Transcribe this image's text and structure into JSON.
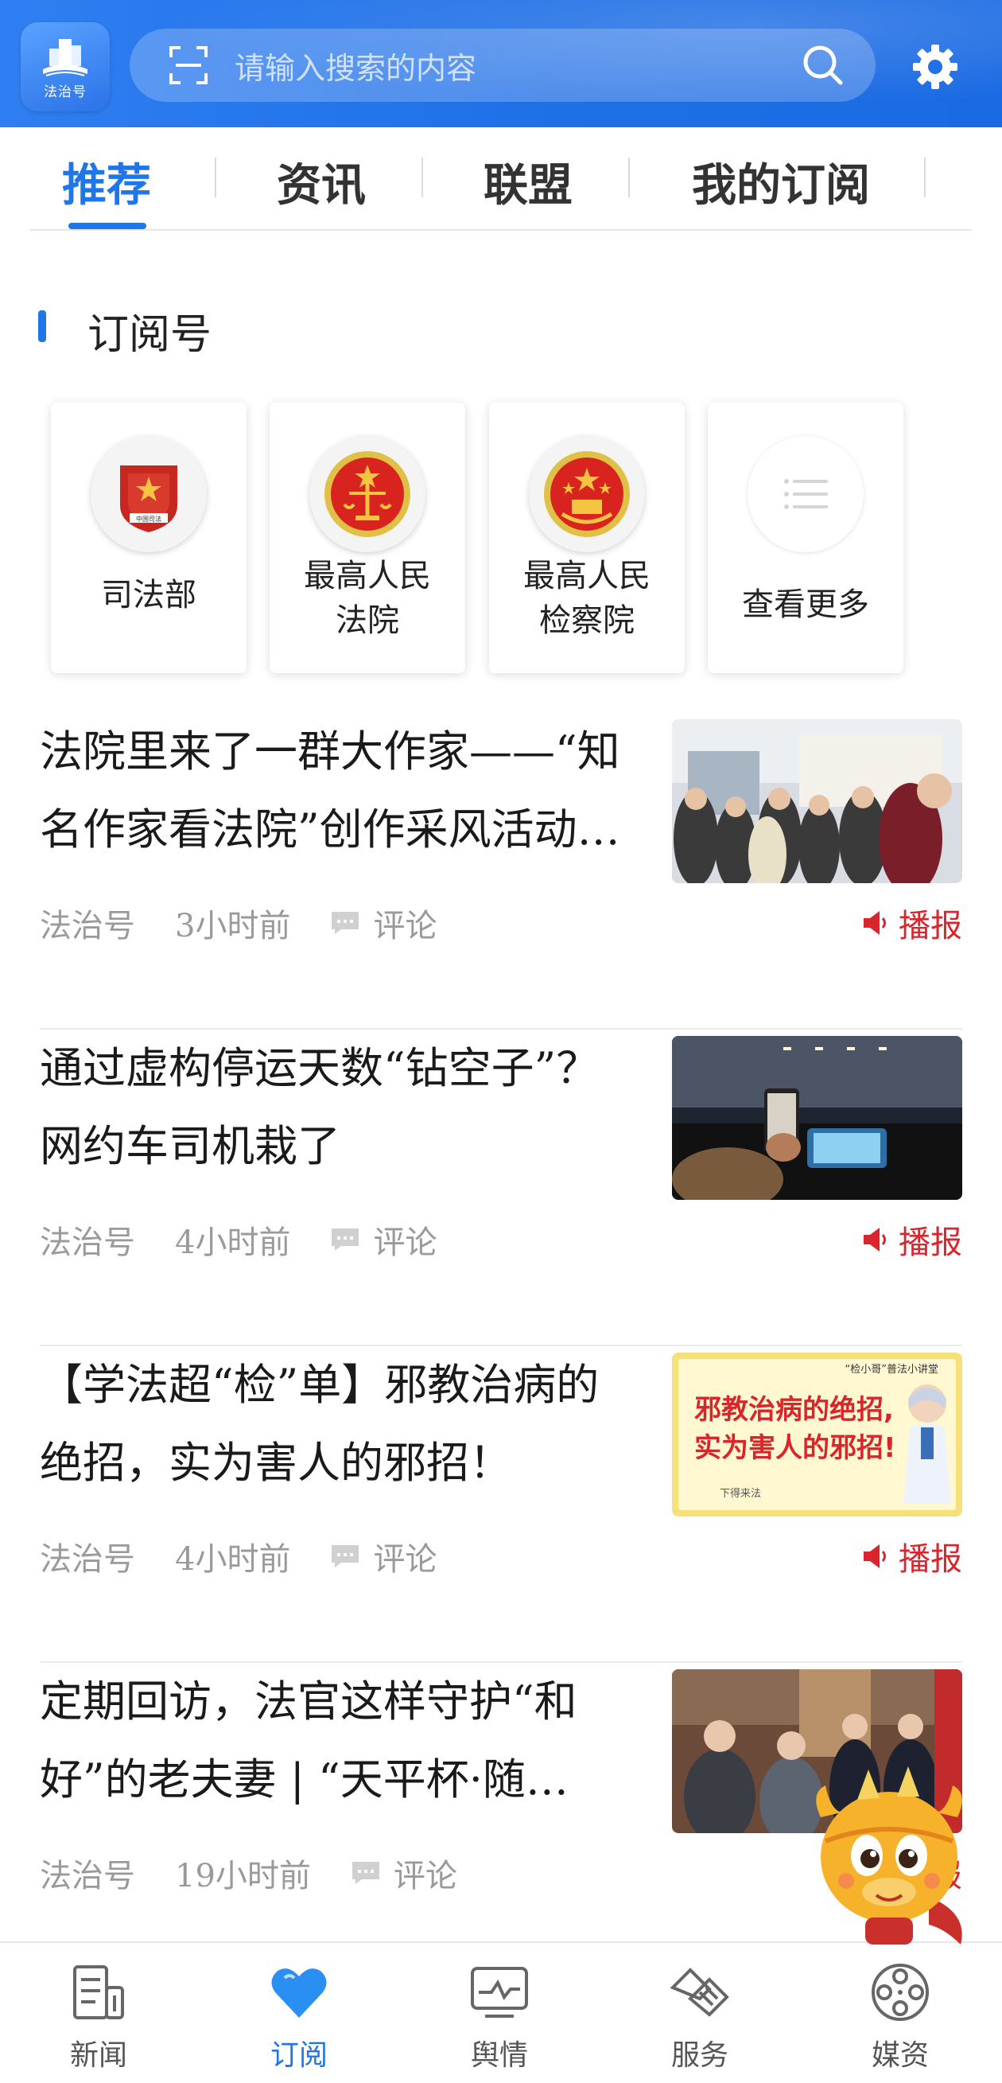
{
  "header": {
    "logo_text": "法治号",
    "search_placeholder": "请输入搜索的内容"
  },
  "tabs": [
    {
      "label": "推荐",
      "active": true
    },
    {
      "label": "资讯",
      "active": false
    },
    {
      "label": "联盟",
      "active": false
    },
    {
      "label": "我的订阅",
      "active": false
    }
  ],
  "subscriptions": {
    "title": "订阅号",
    "cards": [
      {
        "name": "司法部",
        "icon": "ministry-of-justice-emblem"
      },
      {
        "name_line1": "最高人民",
        "name_line2": "法院",
        "icon": "supreme-court-emblem"
      },
      {
        "name_line1": "最高人民",
        "name_line2": "检察院",
        "icon": "procuratorate-emblem"
      },
      {
        "name": "查看更多",
        "icon": "list-icon"
      }
    ]
  },
  "news": [
    {
      "title_line1": "法院里来了一群大作家——“知",
      "title_line2": "名作家看法院”创作采风活动…",
      "source": "法治号",
      "time": "3小时前",
      "comment_label": "评论",
      "broadcast_label": "播报"
    },
    {
      "title_line1": "通过虚构停运天数“钻空子”？",
      "title_line2": "网约车司机栽了",
      "source": "法治号",
      "time": "4小时前",
      "comment_label": "评论",
      "broadcast_label": "播报"
    },
    {
      "title_line1": "【学法超“检”单】邪教治病的",
      "title_line2": "绝招，实为害人的邪招！",
      "thumb_small": "“检小哥”普法小讲堂",
      "thumb_line1": "邪教治病的绝招,",
      "thumb_line2": "实为害人的邪招!",
      "thumb_sign": "下得来法",
      "source": "法治号",
      "time": "4小时前",
      "comment_label": "评论",
      "broadcast_label": "播报"
    },
    {
      "title_line1": "定期回访，法官这样守护“和",
      "title_line2": "好”的老夫妻 | “天平杯·随…",
      "source": "法治号",
      "time": "19小时前",
      "comment_label": "评论",
      "broadcast_label": "播报"
    }
  ],
  "bottom_nav": [
    {
      "label": "新闻",
      "icon": "newspaper-icon",
      "active": false
    },
    {
      "label": "订阅",
      "icon": "heart-icon",
      "active": true
    },
    {
      "label": "舆情",
      "icon": "monitor-icon",
      "active": false
    },
    {
      "label": "服务",
      "icon": "handshake-icon",
      "active": false
    },
    {
      "label": "媒资",
      "icon": "film-reel-icon",
      "active": false
    }
  ],
  "colors": {
    "accent": "#1f76e8",
    "broadcast_red": "#d8262c",
    "meta_gray": "#9a9a9a"
  }
}
